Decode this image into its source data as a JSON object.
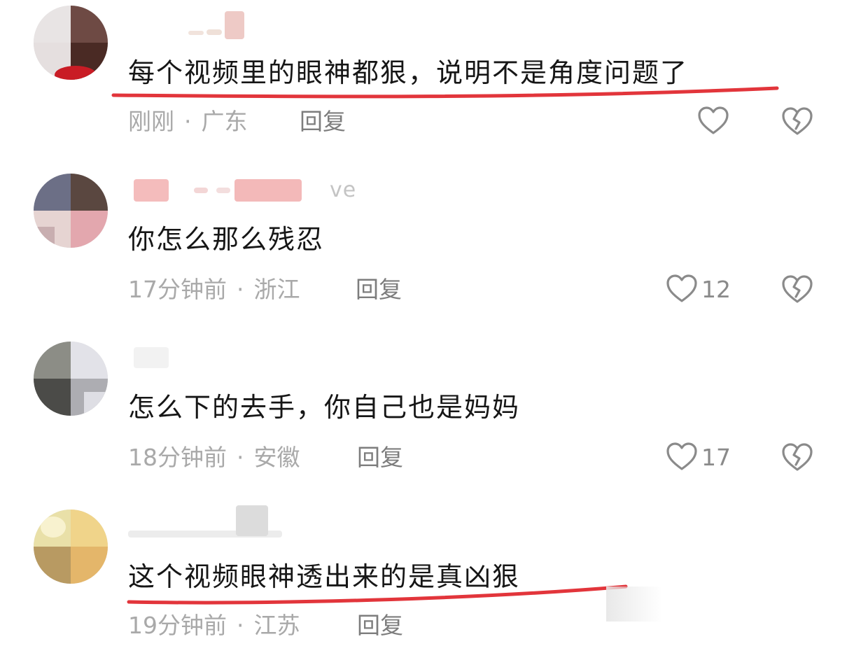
{
  "comments": [
    {
      "username_suffix": "",
      "text": "每个视频里的眼神都狠，说明不是角度问题了",
      "time": "刚刚",
      "region": "广东",
      "reply_label": "回复",
      "likes": ""
    },
    {
      "username_suffix": "ve",
      "text": "你怎么那么残忍",
      "time": "17分钟前",
      "region": "浙江",
      "reply_label": "回复",
      "likes": "12"
    },
    {
      "username_suffix": "",
      "text": "怎么下的去手，你自己也是妈妈",
      "time": "18分钟前",
      "region": "安徽",
      "reply_label": "回复",
      "likes": "17"
    },
    {
      "username_suffix": "",
      "text": "这个视频眼神透出来的是真凶狠",
      "time": "19分钟前",
      "region": "江苏",
      "reply_label": "回复",
      "likes": ""
    }
  ],
  "separator": "·",
  "colors": {
    "underline": "#e2353b",
    "meta_text": "#a9a9a9",
    "icon_stroke": "#8a8a8a"
  },
  "icons": {
    "like": "heart-outline-icon",
    "dislike": "broken-heart-icon"
  }
}
